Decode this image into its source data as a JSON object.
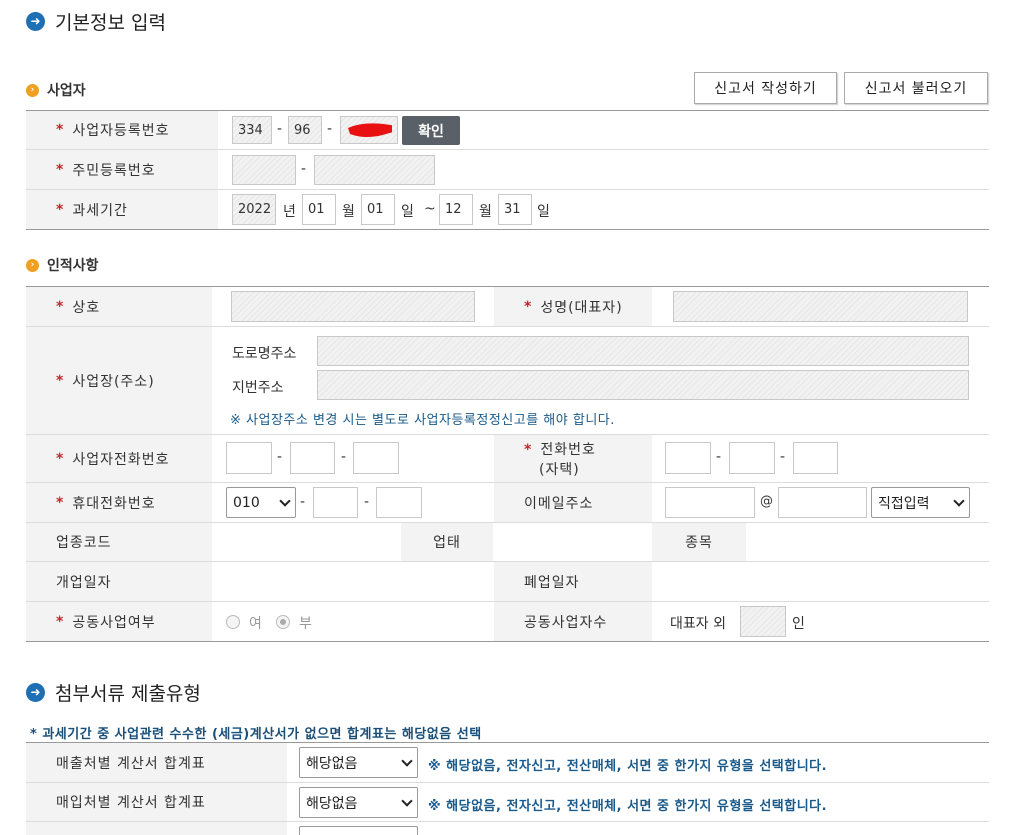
{
  "page": {
    "title": "기본정보 입력"
  },
  "business": {
    "title": "사업자",
    "write_btn": "신고서 작성하기",
    "load_btn": "신고서 불러오기",
    "reg_no_label": "사업자등록번호",
    "reg_no_1": "334",
    "reg_no_2": "96",
    "confirm_btn": "확인",
    "resident_label": "주민등록번호",
    "period_label": "과세기간",
    "year": "2022",
    "year_unit": "년",
    "start_month": "01",
    "month_unit": "월",
    "start_day": "01",
    "day_unit": "일",
    "tilde": "~",
    "end_month": "12",
    "end_day": "31",
    "dash": "-"
  },
  "personal": {
    "title": "인적사항",
    "company_label": "상호",
    "rep_label": "성명(대표자)",
    "address_label": "사업장(주소)",
    "road_label": "도로명주소",
    "lot_label": "지번주소",
    "address_note": "※ 사업장주소 변경 시는 별도로 사업자등록정정신고를 해야 합니다.",
    "biz_phone_label": "사업자전화번호",
    "home_phone_label_1": "전화번호",
    "home_phone_label_2": "(자택)",
    "mobile_label": "휴대전화번호",
    "mobile_prefix": "010",
    "email_label": "이메일주소",
    "at": "@",
    "email_domain": "직접입력",
    "industry_code_label": "업종코드",
    "biz_type_label": "업태",
    "item_label": "종목",
    "open_date_label": "개업일자",
    "close_date_label": "폐업일자",
    "joint_label": "공동사업여부",
    "yes": "여",
    "no": "부",
    "joint_count_label": "공동사업자수",
    "rep_other": "대표자 외",
    "person_unit": "인"
  },
  "attach": {
    "title": "첨부서류 제출유형",
    "note": "* 과세기간 중 사업관련 수수한 (세금)계산서가 없으면 합계표는 해당없음 선택",
    "rows": [
      {
        "label": "매출처별 계산서 합계표",
        "value": "해당없음",
        "hint": "※ 해당없음, 전자신고, 전산매체, 서면 중 한가지 유형을 선택합니다."
      },
      {
        "label": "매입처별 계산서 합계표",
        "value": "해당없음",
        "hint": "※ 해당없음, 전자신고, 전산매체, 서면 중 한가지 유형을 선택합니다."
      }
    ]
  }
}
